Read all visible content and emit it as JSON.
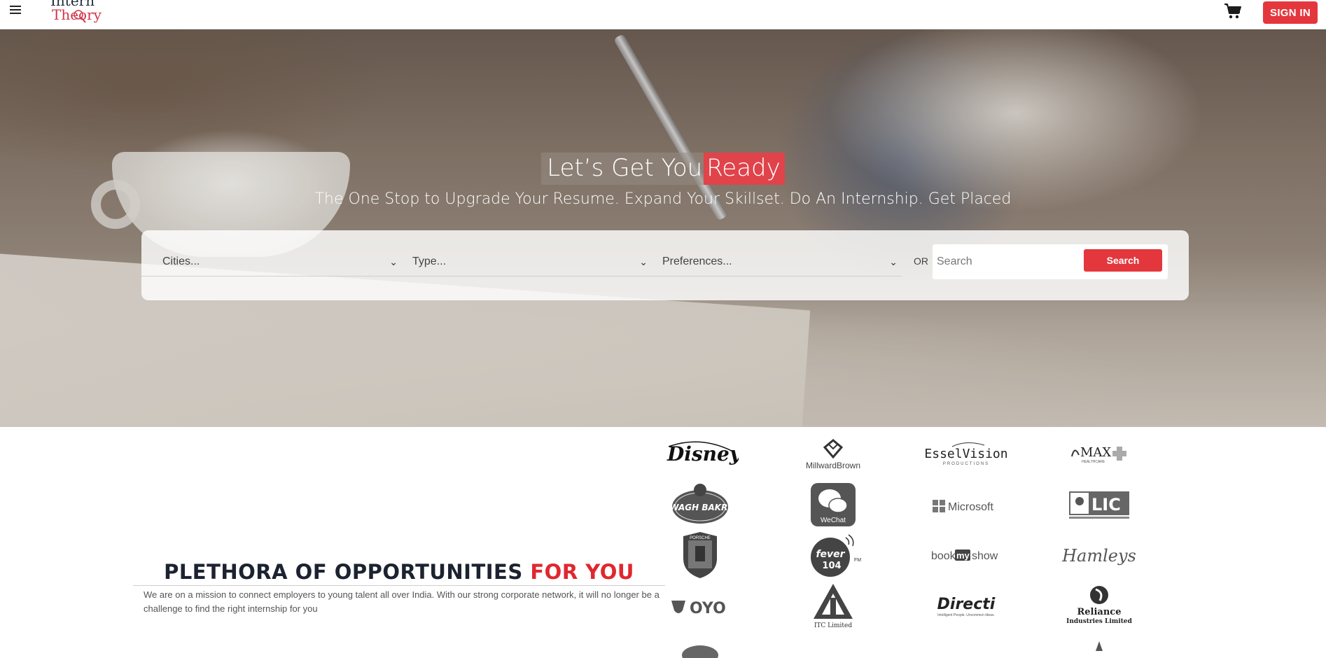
{
  "header": {
    "logo_text_top": "Intern",
    "logo_text_bottom": "Theory",
    "signin_label": "SIGN IN",
    "icons": [
      "hamburger-menu-icon",
      "cart-icon"
    ]
  },
  "hero": {
    "title_part1": "Let’s Get You",
    "title_part2": "Ready",
    "subtitle": "The One Stop to Upgrade Your Resume. Expand Your Skillset. Do An Internship. Get Placed",
    "filters": {
      "cities_placeholder": "Cities...",
      "type_placeholder": "Type...",
      "preferences_placeholder": "Preferences..."
    },
    "or_label": "OR",
    "search_placeholder": "Search",
    "search_button": "Search"
  },
  "opportunities": {
    "title_part1": "PLETHORA OF OPPORTUNITIES",
    "title_part2": "FOR YOU",
    "description": "We are on a mission to connect employers to young talent all over India. With our strong corporate network, it will no longer be a challenge to find the right internship for you"
  },
  "partner_logos": {
    "disney": "Disney",
    "millwardbrown": "MillwardBrown",
    "esselvision": "EsselVision",
    "esselvision_sub": "PRODUCTIONS",
    "max": "MAX",
    "max_sub": "HEALTHCARE",
    "waghbakri": "WAGH BAKRI",
    "wechat": "WeChat",
    "microsoft": "Microsoft",
    "lic": "LIC",
    "porsche": "PORSCHE",
    "fever": "fever",
    "fever_freq": "104",
    "fever_fm": "FM",
    "bookmyshow_1": "book",
    "bookmyshow_2": "my",
    "bookmyshow_3": "show",
    "hamleys": "Hamleys",
    "oyo": "OYO",
    "itc": "ITC Limited",
    "directi": "Directi",
    "directi_sub": "Intelligent People. Uncommon Ideas.",
    "reliance_1": "Reliance",
    "reliance_2": "Industries Limited"
  },
  "colors": {
    "accent": "#e4373d",
    "heading_dark": "#1c2230"
  }
}
